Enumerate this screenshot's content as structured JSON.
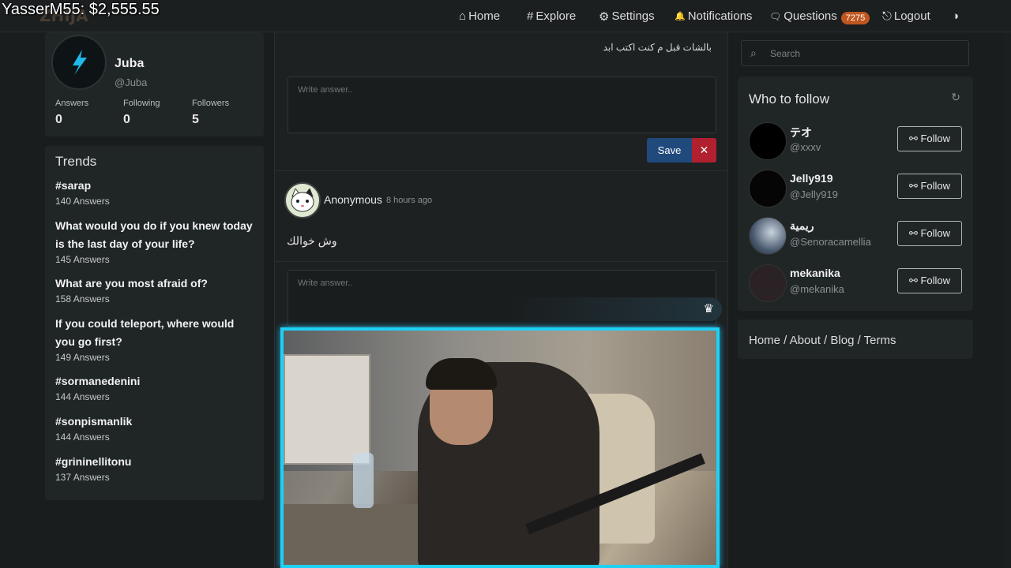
{
  "overlay": {
    "text": "YasserM55: $2,555.55"
  },
  "nav": {
    "logo": "ZHIJA",
    "items": [
      {
        "icon": "home-icon",
        "glyph": "⌂",
        "label": "Home"
      },
      {
        "icon": "hash-icon",
        "glyph": "#",
        "label": "Explore"
      },
      {
        "icon": "gear-icon",
        "glyph": "⚙",
        "label": "Settings"
      },
      {
        "icon": "bell-icon",
        "glyph": "🔔",
        "label": "Notifications"
      },
      {
        "icon": "chat-icon",
        "glyph": "🗨",
        "label": "Questions",
        "badge": "7275"
      },
      {
        "icon": "logout-icon",
        "glyph": "⎋",
        "label": "Logout"
      }
    ],
    "theme_glyph": "◑"
  },
  "profile": {
    "name": "Juba",
    "handle": "@Juba",
    "stats": [
      {
        "label": "Answers",
        "value": "0"
      },
      {
        "label": "Following",
        "value": "0"
      },
      {
        "label": "Followers",
        "value": "5"
      }
    ]
  },
  "trends": {
    "title": "Trends",
    "items": [
      {
        "title": "#sarap",
        "count": "140 Answers"
      },
      {
        "title": "What would you do if you knew today is the last day of your life?",
        "count": "145 Answers"
      },
      {
        "title": "What are you most afraid of?",
        "count": "158 Answers"
      },
      {
        "title": "If you could teleport, where would you go first?",
        "count": "149 Answers"
      },
      {
        "title": "#sormanedenini",
        "count": "144 Answers"
      },
      {
        "title": "#sonpismanlik",
        "count": "144 Answers"
      },
      {
        "title": "#grininellitonu",
        "count": "137 Answers"
      }
    ]
  },
  "feed": {
    "prev_question_text": "بالشات قبل م كنت اكتب ابد",
    "answer_placeholder": "Write answer..",
    "save_label": "Save",
    "cancel_glyph": "✕",
    "post": {
      "author": "Anonymous",
      "time": "8 hours ago",
      "message": "وش خوالك"
    }
  },
  "sidebar": {
    "search_placeholder": "Search",
    "who_to_follow_title": "Who to follow",
    "follow_label": "Follow",
    "users": [
      {
        "name": "テオ",
        "handle": "@xxxv"
      },
      {
        "name": "Jelly919",
        "handle": "@Jelly919"
      },
      {
        "name": "ريمية",
        "handle": "@Senoracamellia"
      },
      {
        "name": "mekanika",
        "handle": "@mekanika"
      }
    ],
    "footer_links": "Home / About / Blog / Terms"
  },
  "colors": {
    "accent": "#214a7c",
    "danger": "#b0202e",
    "badge": "#c0561f",
    "cam_border": "#1fd0f5"
  }
}
